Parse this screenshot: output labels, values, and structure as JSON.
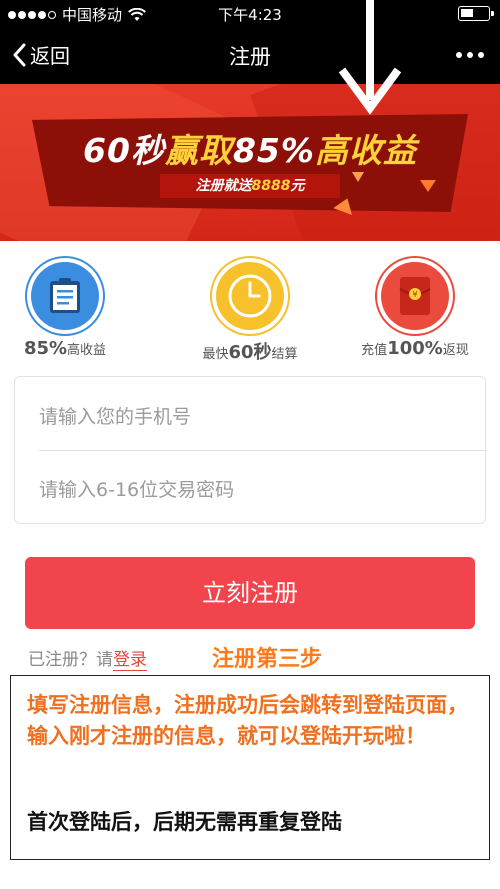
{
  "status_bar": {
    "carrier": "中国移动",
    "time": "下午4:23",
    "signal_bars": 4,
    "battery_level": 0.45
  },
  "nav": {
    "back_label": "返回",
    "title": "注册"
  },
  "banner": {
    "title_part1": "60秒",
    "title_part2": "赢取",
    "title_part3": "85%",
    "title_part4": "高收益",
    "subtitle_part1": "注册就送",
    "subtitle_part2": "8888",
    "subtitle_part3": "元"
  },
  "features": [
    {
      "num": "85%",
      "suffix": "高收益",
      "prefix": "",
      "icon": "clipboard-icon"
    },
    {
      "prefix": "最快",
      "num": "60秒",
      "suffix": "结算",
      "icon": "clock-icon"
    },
    {
      "prefix": "充值",
      "num": "100%",
      "suffix": "返现",
      "icon": "red-envelope-icon"
    }
  ],
  "form": {
    "phone_placeholder": "请输入您的手机号",
    "password_placeholder": "请输入6-16位交易密码"
  },
  "register_button": "立刻注册",
  "login": {
    "prompt": "已注册？请",
    "link": "登录"
  },
  "step_label": "注册第三步",
  "instructions": {
    "orange": "填写注册信息，注册成功后会跳转到登陆页面，输入刚才注册的信息，就可以登陆开玩啦！",
    "black": "首次登陆后，后期无需再重复登陆"
  },
  "colors": {
    "accent_red": "#f2444c",
    "banner_red": "#d42618",
    "gold": "#ffd23a",
    "orange": "#f07020",
    "blue_icon": "#3b8de0",
    "yellow_icon": "#f6c12b",
    "red_icon": "#ea4b3c"
  }
}
